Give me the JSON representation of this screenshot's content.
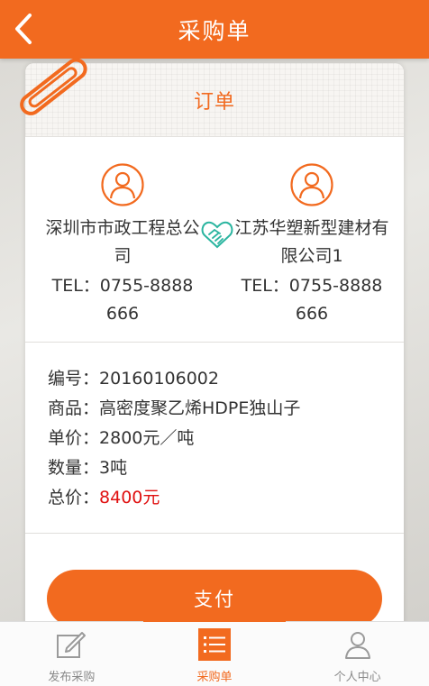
{
  "header": {
    "title": "采购单",
    "back_icon": "chevron-left-icon"
  },
  "card": {
    "title": "订单"
  },
  "buyer": {
    "name": "深圳市市政工程总公司",
    "tel": "TEL：0755-8888666"
  },
  "seller": {
    "name": "江苏华塑新型建材有限公司1",
    "tel": "TEL：0755-8888666"
  },
  "order": {
    "number_label": "编号：",
    "number": "20160106002",
    "product_label": "商品：",
    "product": "高密度聚乙烯HDPE独山子",
    "price_label": "单价：",
    "price": "2800元／吨",
    "qty_label": "数量：",
    "qty": "3吨",
    "total_label": "总价：",
    "total": "8400元"
  },
  "pay_button": "支付",
  "tabs": [
    {
      "label": "发布采购",
      "icon": "edit-icon",
      "active": false
    },
    {
      "label": "采购单",
      "icon": "list-icon",
      "active": true
    },
    {
      "label": "个人中心",
      "icon": "user-icon",
      "active": false
    }
  ],
  "colors": {
    "accent": "#f26a1f",
    "price_red": "#e01010",
    "handshake": "#2bb5a0"
  }
}
